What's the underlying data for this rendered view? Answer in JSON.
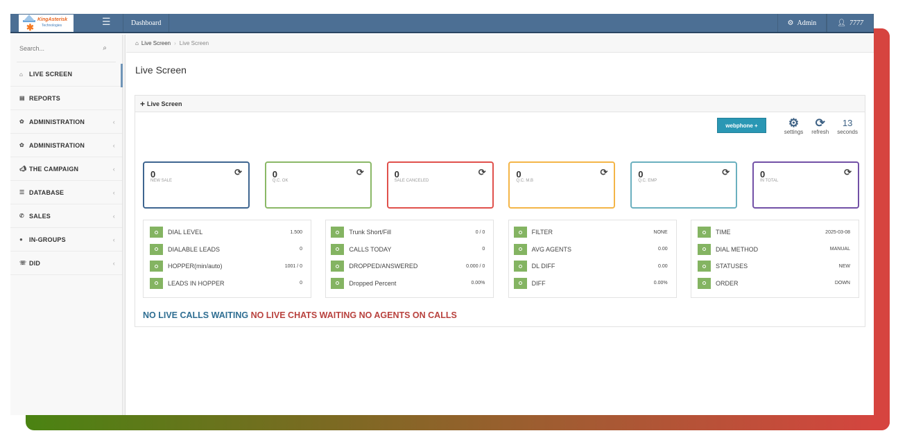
{
  "colors": {
    "topbar": "#4c6f94",
    "accent_green": "#84b462",
    "webphone_button": "#2a97b4",
    "status_blue": "#2f6e92",
    "status_red": "#b8413d",
    "frame_gradient_start": "#4a8312",
    "frame_gradient_end": "#d6443f"
  },
  "topbar": {
    "logo": {
      "brand": "KingAsterisk",
      "sub": "Technologies"
    },
    "menu_icon": "hamburger-icon",
    "nav": [
      {
        "label": "Dashboard"
      }
    ],
    "right": [
      {
        "icon": "cogs-icon",
        "label": "Admin"
      },
      {
        "icon": "user-icon",
        "label": "7777"
      }
    ]
  },
  "sidebar": {
    "search_placeholder": "Search...",
    "items": [
      {
        "label": "LIVE SCREEN",
        "icon": "home-icon",
        "active": true,
        "has_submenu": false
      },
      {
        "label": "REPORTS",
        "icon": "chart-icon",
        "active": false,
        "has_submenu": false
      },
      {
        "label": "ADMINISTRATION",
        "icon": "gear-icon",
        "active": false,
        "has_submenu": true
      },
      {
        "label": "ADMINISTRATION",
        "icon": "gear-icon",
        "active": false,
        "has_submenu": true
      },
      {
        "label": "THE CAMPAIGN",
        "icon": "bullhorn-icon",
        "active": false,
        "has_submenu": true
      },
      {
        "label": "DATABASE",
        "icon": "database-icon",
        "active": false,
        "has_submenu": true
      },
      {
        "label": "SALES",
        "icon": "phone-icon",
        "active": false,
        "has_submenu": true
      },
      {
        "label": "IN-GROUPS",
        "icon": "user-icon",
        "active": false,
        "has_submenu": true
      },
      {
        "label": "DID",
        "icon": "phone-icon",
        "active": false,
        "has_submenu": true
      }
    ]
  },
  "breadcrumb": {
    "root": "Live Screen",
    "current": "Live Screen"
  },
  "page_title": "Live Screen",
  "panel": {
    "title": "Live Screen",
    "toolbar": {
      "webphone_label": "webphone +",
      "settings_label": "settings",
      "refresh_label": "refresh",
      "counter_value": "13",
      "counter_label": "seconds"
    },
    "cards": [
      {
        "value": "0",
        "label": "NEW SALE",
        "color": "#3e6590"
      },
      {
        "value": "0",
        "label": "Q.C. OK",
        "color": "#8ab866"
      },
      {
        "value": "0",
        "label": "SALE CANCELED",
        "color": "#e0504b"
      },
      {
        "value": "0",
        "label": "Q.C. M.B",
        "color": "#f4b547"
      },
      {
        "value": "0",
        "label": "Q.C. EMP",
        "color": "#6ab0bf"
      },
      {
        "value": "0",
        "label": "IN TOTAL",
        "color": "#7250a6"
      }
    ],
    "stats": [
      [
        {
          "key": "DIAL LEVEL",
          "value": "1.500"
        },
        {
          "key": "DIALABLE LEADS",
          "value": "0"
        },
        {
          "key": "HOPPER(min/auto)",
          "value": "1001 / 0"
        },
        {
          "key": "LEADS IN HOPPER",
          "value": "0"
        }
      ],
      [
        {
          "key": "Trunk Short/Fill",
          "value": "0 / 0"
        },
        {
          "key": "CALLS TODAY",
          "value": "0"
        },
        {
          "key": "DROPPED/ANSWERED",
          "value": "0.000 / 0"
        },
        {
          "key": "Dropped Percent",
          "value": "0.00%"
        }
      ],
      [
        {
          "key": "FILTER",
          "value": "NONE"
        },
        {
          "key": "AVG AGENTS",
          "value": "0.00"
        },
        {
          "key": "DL DIFF",
          "value": "0.00"
        },
        {
          "key": "DIFF",
          "value": "0.00%"
        }
      ],
      [
        {
          "key": "TIME",
          "value": "2025-03-08"
        },
        {
          "key": "DIAL METHOD",
          "value": "MANUAL"
        },
        {
          "key": "STATUSES",
          "value": "NEW"
        },
        {
          "key": "ORDER",
          "value": "DOWN"
        }
      ]
    ],
    "status": {
      "calls": "NO LIVE CALLS WAITING",
      "chats": "NO LIVE CHATS WAITING",
      "agents": "NO AGENTS ON CALLS"
    }
  }
}
